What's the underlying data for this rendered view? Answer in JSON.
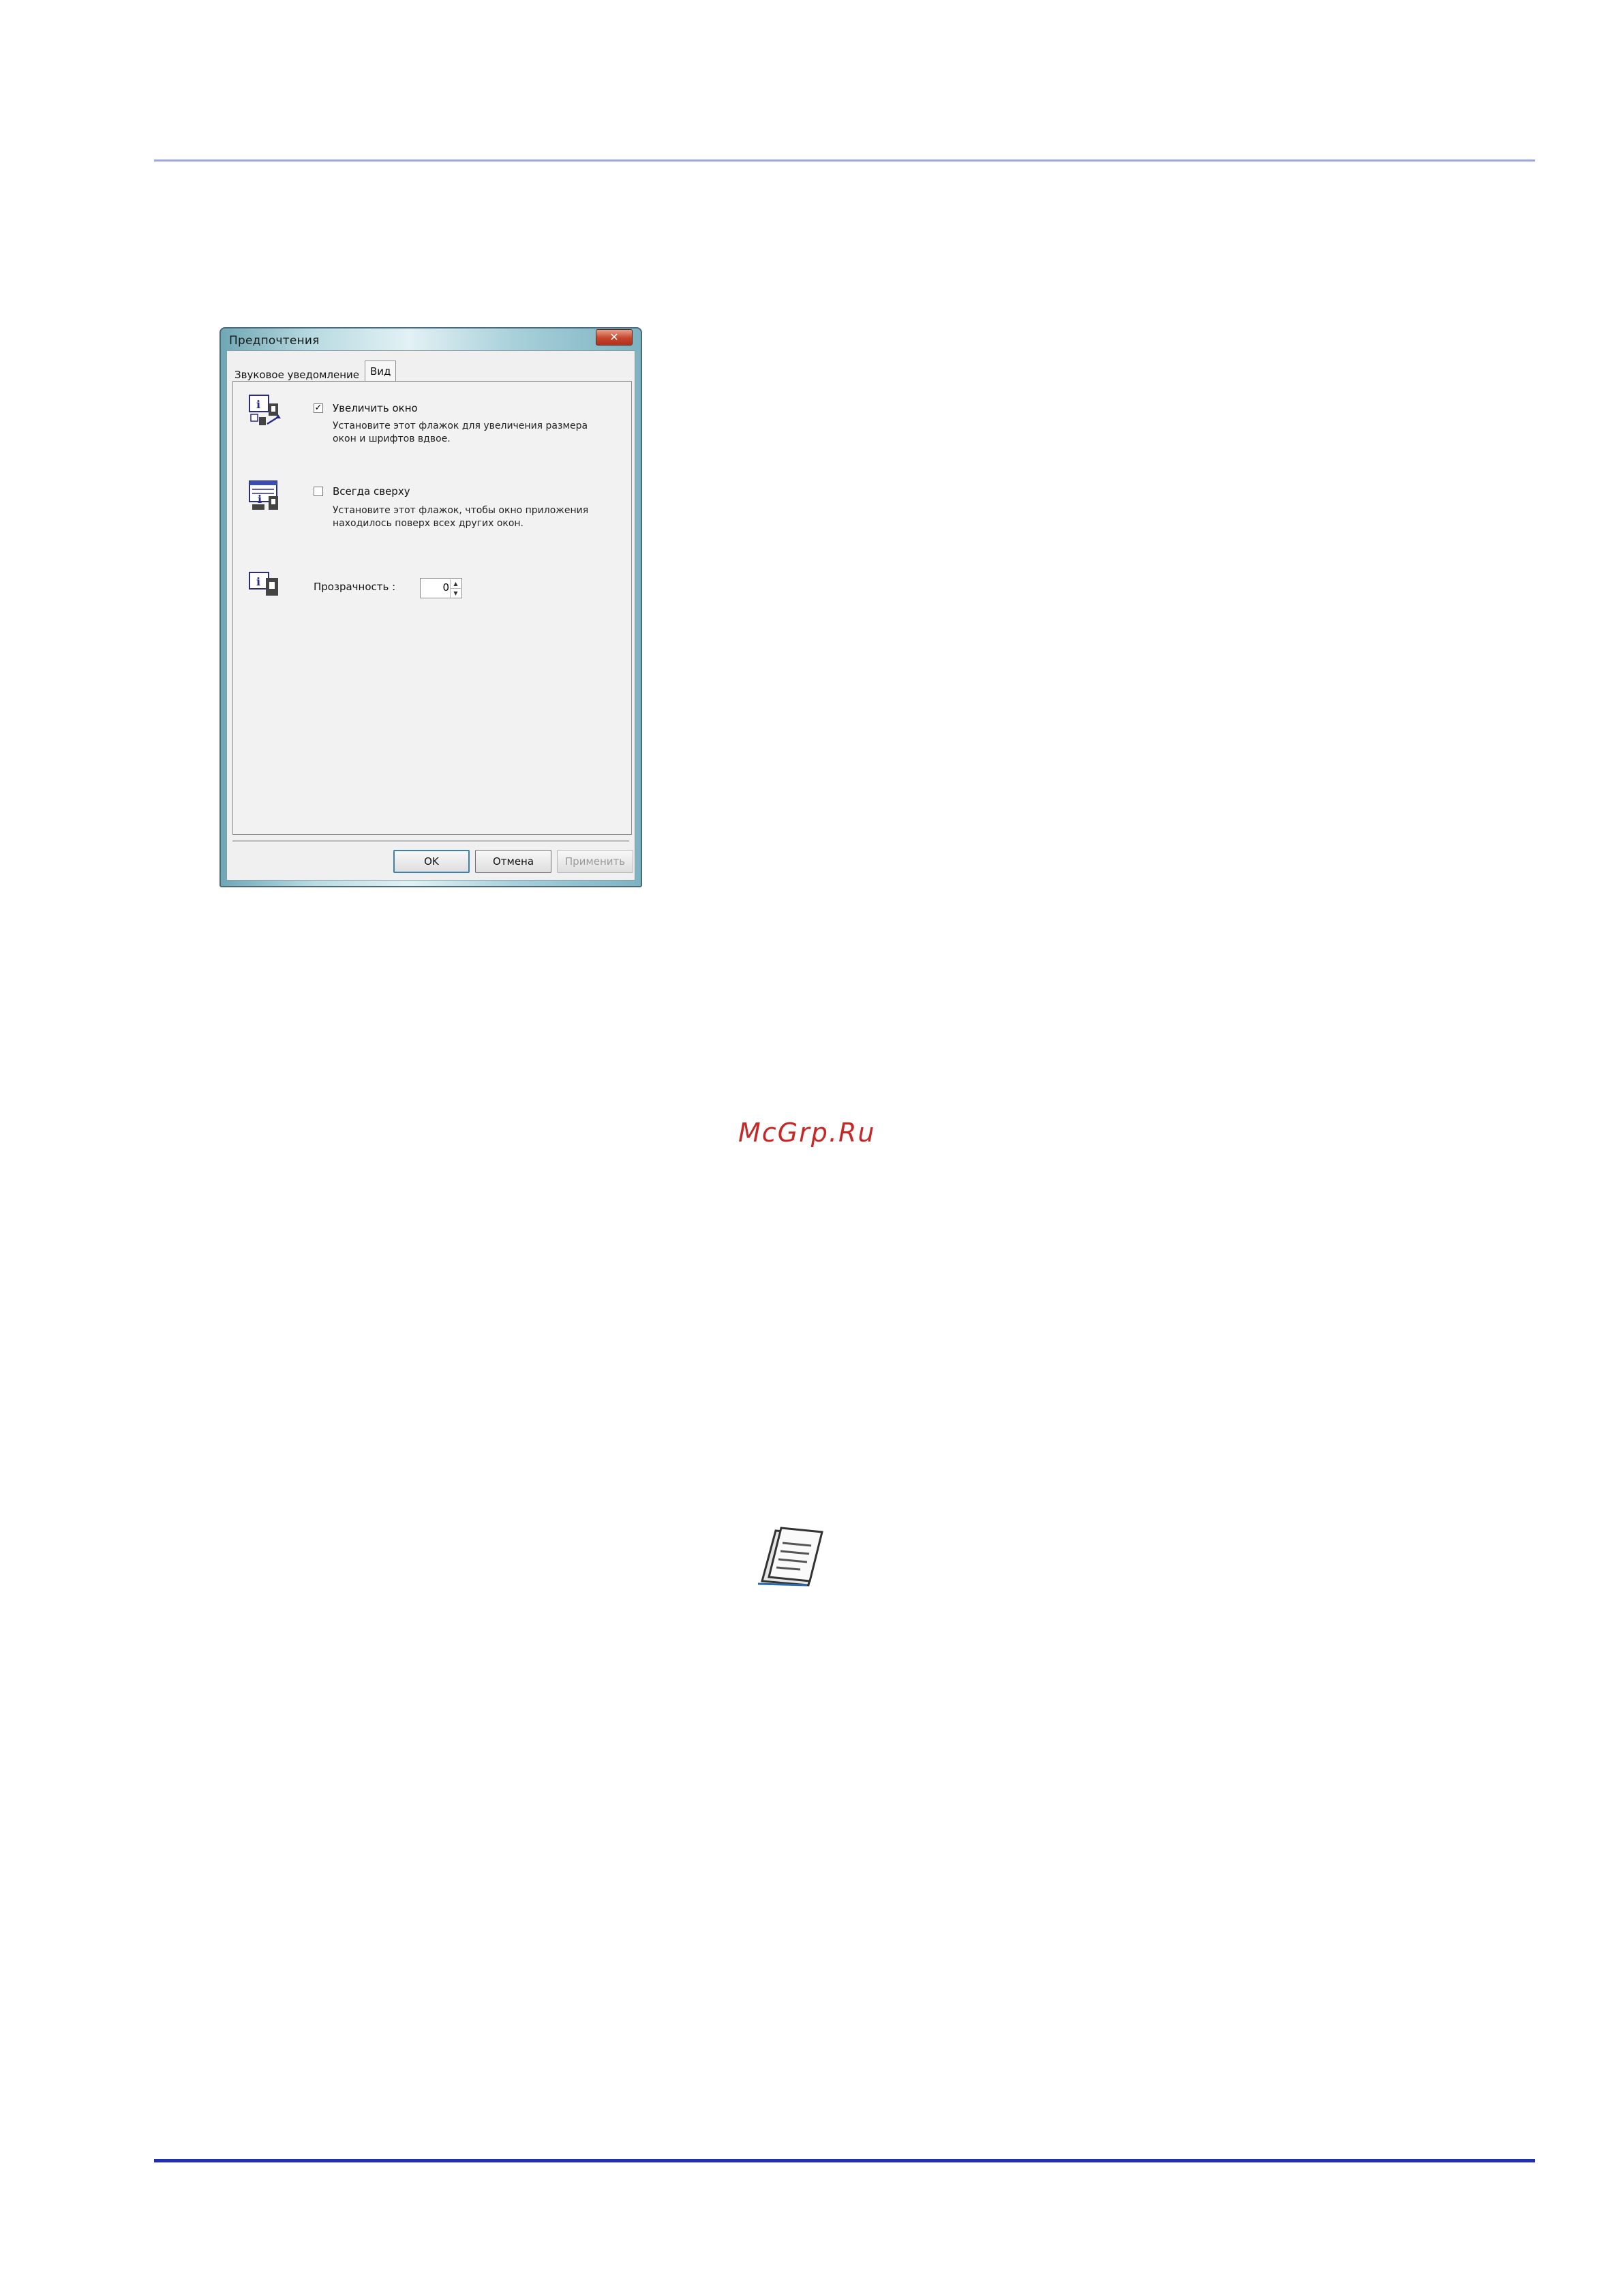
{
  "dialog": {
    "title": "Предпочтения",
    "close_label": "✕",
    "tabs": [
      {
        "label": "Звуковое уведомление"
      },
      {
        "label": "Вид"
      }
    ],
    "options": {
      "zoom": {
        "label": "Увеличить окно",
        "checked": true,
        "desc_line1": "Установите этот флажок для увеличения размера",
        "desc_line2": "окон и шрифтов вдвое."
      },
      "top": {
        "label": "Всегда сверху",
        "checked": false,
        "desc_line1": "Установите этот флажок, чтобы окно приложения",
        "desc_line2": "находилось поверх всех других окон."
      },
      "transparency": {
        "label": "Прозрачность :",
        "value": "0"
      }
    },
    "buttons": {
      "ok": "OK",
      "cancel": "Отмена",
      "apply": "Применить"
    }
  },
  "watermark": "McGrp.Ru",
  "colors": {
    "top_rule": "#9fa6e8",
    "bottom_rule": "#1f2fb8",
    "watermark": "#c62828"
  }
}
